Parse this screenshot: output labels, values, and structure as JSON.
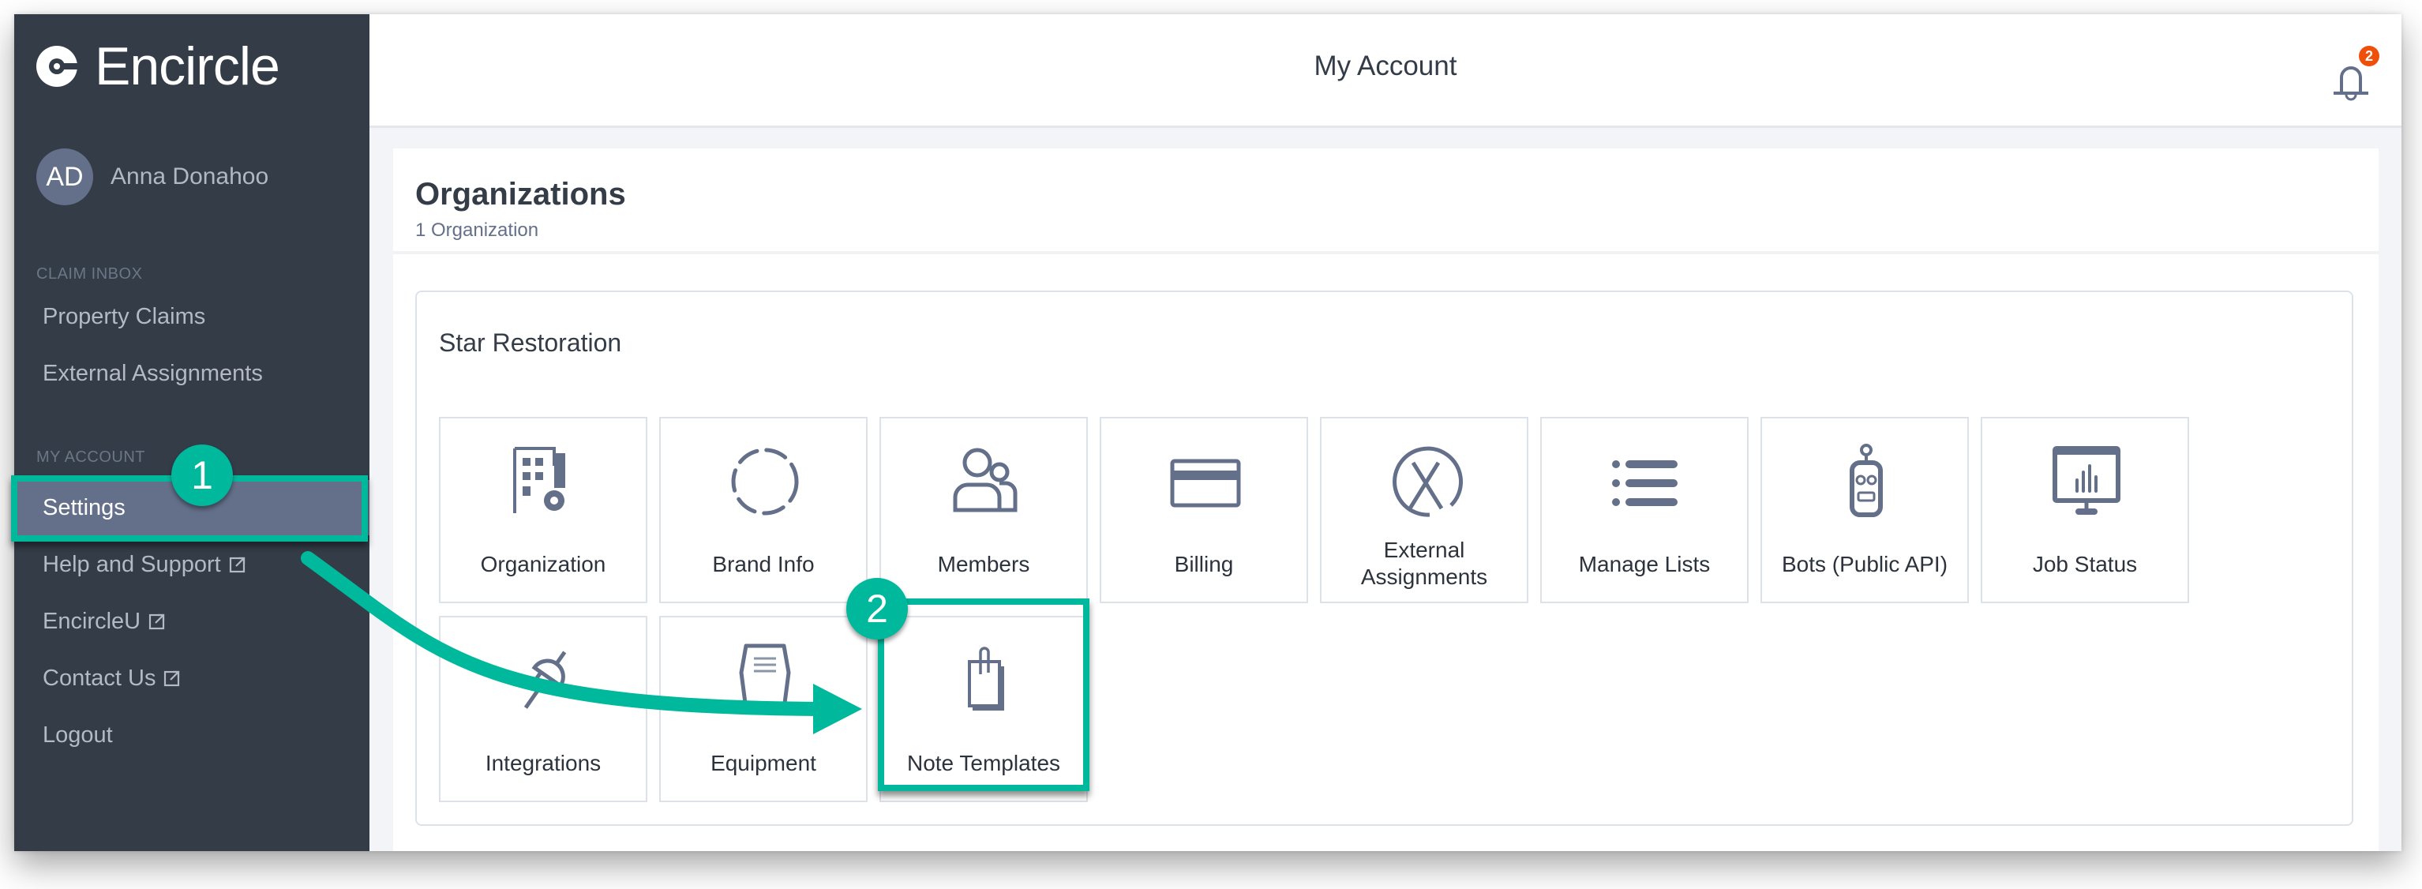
{
  "app": {
    "brand": "Encircle"
  },
  "user": {
    "initials": "AD",
    "name": "Anna Donahoo"
  },
  "sidebar": {
    "sections": [
      {
        "label": "CLAIM INBOX",
        "items": [
          {
            "label": "Property Claims"
          },
          {
            "label": "External Assignments"
          }
        ]
      },
      {
        "label": "MY ACCOUNT",
        "items": [
          {
            "label": "Settings",
            "active": true
          },
          {
            "label": "Help and Support",
            "external": true
          },
          {
            "label": "EncircleU",
            "external": true
          },
          {
            "label": "Contact Us",
            "external": true
          },
          {
            "label": "Logout"
          }
        ]
      }
    ]
  },
  "header": {
    "title": "My Account",
    "notification_count": "2"
  },
  "main": {
    "title": "Organizations",
    "subtitle": "1 Organization",
    "organization": {
      "name": "Star Restoration",
      "tiles": [
        {
          "label": "Organization",
          "icon": "building-gear-icon"
        },
        {
          "label": "Brand Info",
          "icon": "dashed-circle-icon"
        },
        {
          "label": "Members",
          "icon": "users-icon"
        },
        {
          "label": "Billing",
          "icon": "credit-card-icon"
        },
        {
          "label": "External Assignments",
          "icon": "circle-x-icon"
        },
        {
          "label": "Manage Lists",
          "icon": "list-icon"
        },
        {
          "label": "Bots (Public API)",
          "icon": "robot-icon"
        },
        {
          "label": "Job Status",
          "icon": "presentation-chart-icon"
        },
        {
          "label": "Integrations",
          "icon": "plug-icon"
        },
        {
          "label": "Equipment",
          "icon": "dehumidifier-icon"
        },
        {
          "label": "Note Templates",
          "icon": "clipped-notes-icon"
        }
      ]
    }
  },
  "annotations": {
    "step1": "1",
    "step2": "2",
    "accent": "#00b89c"
  }
}
